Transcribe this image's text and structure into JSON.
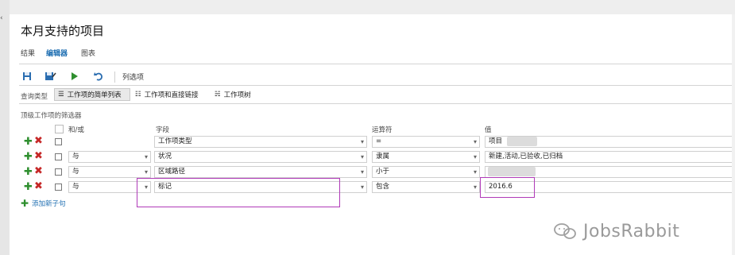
{
  "page": {
    "title": "本月支持的项目"
  },
  "tabs": [
    {
      "label": "结果",
      "active": false
    },
    {
      "label": "编辑器",
      "active": true
    },
    {
      "label": "图表",
      "active": false
    }
  ],
  "toolbar": {
    "icons": [
      "save-icon",
      "save-as-icon",
      "run-icon",
      "undo-icon"
    ],
    "column_options": "列选项"
  },
  "query_type": {
    "label": "查询类型",
    "options": [
      {
        "label": "工作项的简单列表",
        "selected": true
      },
      {
        "label": "工作项和直接链接",
        "selected": false
      },
      {
        "label": "工作项树",
        "selected": false
      }
    ]
  },
  "filter_section": {
    "label": "顶级工作项的筛选器"
  },
  "columns": {
    "and_or": "和/或",
    "field": "字段",
    "operator": "运算符",
    "value": "值"
  },
  "rows": [
    {
      "and_or": "",
      "field": "工作项类型",
      "operator": "=",
      "value": "项目"
    },
    {
      "and_or": "与",
      "field": "状况",
      "operator": "隶属",
      "value": "新建,活动,已验收,已归档"
    },
    {
      "and_or": "与",
      "field": "区域路径",
      "operator": "小于",
      "value": ""
    },
    {
      "and_or": "与",
      "field": "标记",
      "operator": "包含",
      "value": "2016.6"
    }
  ],
  "add_clause": "添加新子句",
  "watermark": "JobsRabbit",
  "colors": {
    "accent": "#1f6fb2",
    "add": "#2f8f2f",
    "delete": "#c62828",
    "highlight": "#b03ab8"
  }
}
